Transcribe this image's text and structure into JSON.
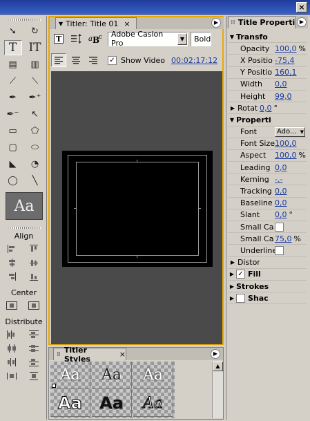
{
  "window": {
    "close_label": "×"
  },
  "toolbox": {
    "align_label": "Align",
    "center_label": "Center",
    "distribute_label": "Distribute",
    "preview_text": "Aa",
    "tools": [
      {
        "name": "selection-tool",
        "glyph": "➘"
      },
      {
        "name": "rotation-tool",
        "glyph": "↻"
      },
      {
        "name": "type-tool",
        "glyph": "T"
      },
      {
        "name": "vertical-type-tool",
        "glyph": "IT"
      },
      {
        "name": "area-type-tool",
        "glyph": "▤"
      },
      {
        "name": "vertical-area-type-tool",
        "glyph": "▥"
      },
      {
        "name": "path-type-tool",
        "glyph": "⟋"
      },
      {
        "name": "vertical-path-type-tool",
        "glyph": "⟍"
      },
      {
        "name": "pen-tool",
        "glyph": "✒"
      },
      {
        "name": "add-anchor-point-tool",
        "glyph": "✒⁺"
      },
      {
        "name": "delete-anchor-point-tool",
        "glyph": "✒⁻"
      },
      {
        "name": "convert-anchor-point-tool",
        "glyph": "↖"
      },
      {
        "name": "rectangle-tool",
        "glyph": "▭"
      },
      {
        "name": "clipped-corner-rectangle-tool",
        "glyph": "⬠"
      },
      {
        "name": "rounded-corner-rectangle-tool",
        "glyph": "▢"
      },
      {
        "name": "rounded-rectangle-tool",
        "glyph": "⬭"
      },
      {
        "name": "wedge-tool",
        "glyph": "◣"
      },
      {
        "name": "arc-tool",
        "glyph": "◔"
      },
      {
        "name": "ellipse-tool",
        "glyph": "◯"
      },
      {
        "name": "line-tool",
        "glyph": "╲"
      }
    ]
  },
  "titler": {
    "tab_title": "Titler: Title 01",
    "font_name": "Adobe Caslon Pro",
    "font_style": "Bold",
    "show_video_label": "Show Video",
    "timecode": "00:02:17:12",
    "tab_close": "×"
  },
  "styles": {
    "tab_title": "Titler Styles",
    "tab_close": "×",
    "swatches": [
      "Aa",
      "Aa",
      "Aa",
      "Aa",
      "Aa",
      "Aa"
    ]
  },
  "properties": {
    "tab_title": "Title Properti",
    "rows": [
      {
        "kind": "section",
        "expanded": true,
        "label": "Transfo"
      },
      {
        "kind": "value",
        "label": "Opacity",
        "value": "100,0",
        "unit": "%"
      },
      {
        "kind": "value",
        "label": "X Positio",
        "value": "-75,4",
        "unit": ""
      },
      {
        "kind": "value",
        "label": "Y Positio",
        "value": "160,1",
        "unit": ""
      },
      {
        "kind": "value",
        "label": "Width",
        "value": "0,0",
        "unit": ""
      },
      {
        "kind": "value",
        "label": "Height",
        "value": "99,0",
        "unit": ""
      },
      {
        "kind": "subsection",
        "label": "Rotat",
        "value": "0,0",
        "unit": "°"
      },
      {
        "kind": "section",
        "expanded": true,
        "label": "Properti"
      },
      {
        "kind": "dropdown",
        "label": "Font",
        "value": "Ado..."
      },
      {
        "kind": "value",
        "label": "Font Size",
        "value": "100,0",
        "unit": ""
      },
      {
        "kind": "value",
        "label": "Aspect",
        "value": "100,0",
        "unit": "%"
      },
      {
        "kind": "value",
        "label": "Leading",
        "value": "0,0",
        "unit": ""
      },
      {
        "kind": "value",
        "label": "Kerning",
        "value": "-.-",
        "unit": ""
      },
      {
        "kind": "value",
        "label": "Tracking",
        "value": "0,0",
        "unit": ""
      },
      {
        "kind": "value",
        "label": "Baseline",
        "value": "0,0",
        "unit": ""
      },
      {
        "kind": "value",
        "label": "Slant",
        "value": "0,0",
        "unit": "°"
      },
      {
        "kind": "checkbox",
        "label": "Small Ca",
        "checked": false
      },
      {
        "kind": "value",
        "label": "Small Ca",
        "value": "75,0",
        "unit": "%"
      },
      {
        "kind": "checkbox",
        "label": "Underline",
        "checked": false
      },
      {
        "kind": "subsection",
        "label": "Distor",
        "value": "",
        "unit": ""
      },
      {
        "kind": "section",
        "expanded": false,
        "label": "Fill",
        "checkbox": true,
        "checked": true
      },
      {
        "kind": "section",
        "expanded": false,
        "label": "Strokes"
      },
      {
        "kind": "section",
        "expanded": false,
        "label": "Shac",
        "checkbox": true,
        "checked": false
      }
    ]
  },
  "colors": {
    "accent_border": "#e8a800",
    "title_bar": "#2a4fb8",
    "link": "#1a3aa0",
    "canvas_bg": "#4a4a4a"
  }
}
